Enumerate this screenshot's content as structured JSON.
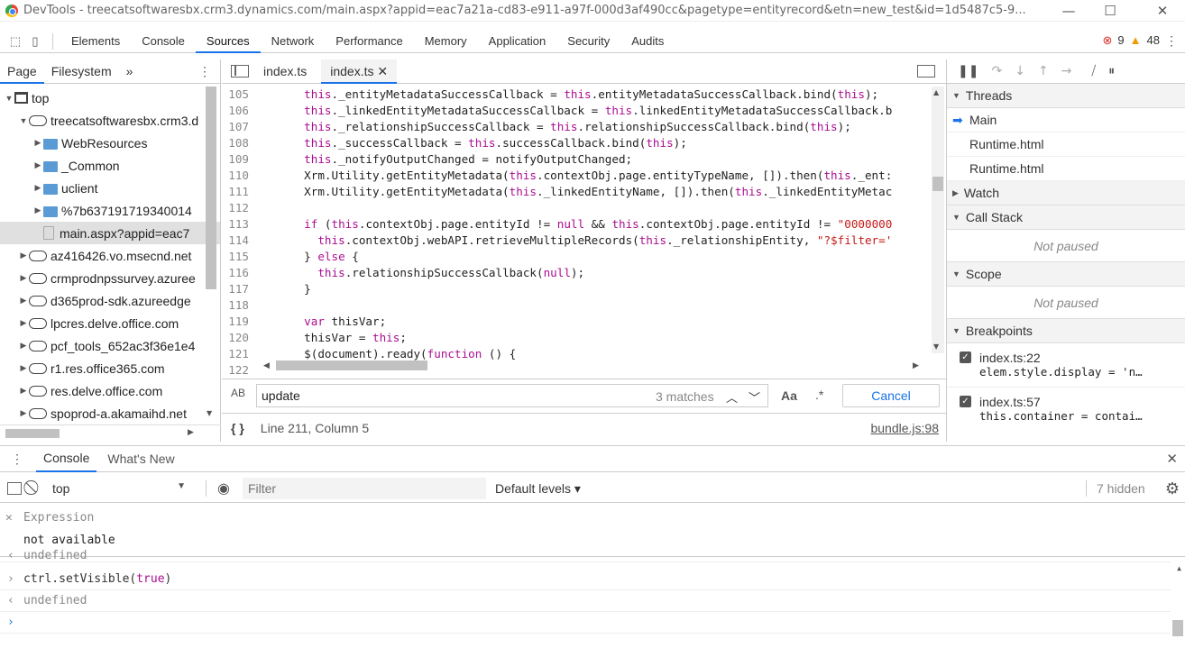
{
  "window": {
    "title": "DevTools - treecatsoftwaresbx.crm3.dynamics.com/main.aspx?appid=eac7a21a-cd83-e911-a97f-000d3af490cc&pagetype=entityrecord&etn=new_test&id=1d5487c5-9...",
    "min": "—",
    "max": "☐",
    "close": "✕"
  },
  "toolbar": {
    "tabs": [
      "Elements",
      "Console",
      "Sources",
      "Network",
      "Performance",
      "Memory",
      "Application",
      "Security",
      "Audits"
    ],
    "active": 2,
    "errors": "9",
    "warnings": "48"
  },
  "navigator": {
    "tabs": [
      "Page",
      "Filesystem"
    ],
    "more": "»",
    "tree": [
      {
        "label": "top",
        "depth": 0,
        "type": "frame",
        "arrow": "▼"
      },
      {
        "label": "treecatsoftwaresbx.crm3.d",
        "depth": 1,
        "type": "cloud",
        "arrow": "▼"
      },
      {
        "label": "WebResources",
        "depth": 2,
        "type": "folder",
        "arrow": "▶"
      },
      {
        "label": "_Common",
        "depth": 2,
        "type": "folder",
        "arrow": "▶"
      },
      {
        "label": "uclient",
        "depth": 2,
        "type": "folder",
        "arrow": "▶"
      },
      {
        "label": "%7b637191719340014",
        "depth": 2,
        "type": "folder",
        "arrow": "▶"
      },
      {
        "label": "main.aspx?appid=eac7",
        "depth": 2,
        "type": "file",
        "arrow": ""
      },
      {
        "label": "az416426.vo.msecnd.net",
        "depth": 1,
        "type": "cloud",
        "arrow": "▶"
      },
      {
        "label": "crmprodnpssurvey.azuree",
        "depth": 1,
        "type": "cloud",
        "arrow": "▶"
      },
      {
        "label": "d365prod-sdk.azureedge",
        "depth": 1,
        "type": "cloud",
        "arrow": "▶"
      },
      {
        "label": "lpcres.delve.office.com",
        "depth": 1,
        "type": "cloud",
        "arrow": "▶"
      },
      {
        "label": "pcf_tools_652ac3f36e1e4",
        "depth": 1,
        "type": "cloud",
        "arrow": "▶"
      },
      {
        "label": "r1.res.office365.com",
        "depth": 1,
        "type": "cloud",
        "arrow": "▶"
      },
      {
        "label": "res.delve.office.com",
        "depth": 1,
        "type": "cloud",
        "arrow": "▶"
      },
      {
        "label": "spoprod-a.akamaihd.net",
        "depth": 1,
        "type": "cloud",
        "arrow": "▶"
      }
    ]
  },
  "editor": {
    "tabs": [
      {
        "label": "index.ts",
        "close": ""
      },
      {
        "label": "index.ts",
        "close": "✕"
      }
    ],
    "lines": [
      {
        "n": "105",
        "html": "  this._entityMetadataSuccessCallback = this.entityMetadataSuccessCallback.bind(this);"
      },
      {
        "n": "106",
        "html": "  this._linkedEntityMetadataSuccessCallback = this.linkedEntityMetadataSuccessCallback.b"
      },
      {
        "n": "107",
        "html": "  this._relationshipSuccessCallback = this.relationshipSuccessCallback.bind(this);"
      },
      {
        "n": "108",
        "html": "  this._successCallback = this.successCallback.bind(this);"
      },
      {
        "n": "109",
        "html": "  this._notifyOutputChanged = notifyOutputChanged;"
      },
      {
        "n": "110",
        "html": "  Xrm.Utility.getEntityMetadata(this.contextObj.page.entityTypeName, []).then(this._ent:"
      },
      {
        "n": "111",
        "html": "  Xrm.Utility.getEntityMetadata(this._linkedEntityName, []).then(this._linkedEntityMetac"
      },
      {
        "n": "112",
        "html": ""
      },
      {
        "n": "113",
        "html": "  if (this.contextObj.page.entityId != null && this.contextObj.page.entityId != \"0000000"
      },
      {
        "n": "114",
        "html": "    this.contextObj.webAPI.retrieveMultipleRecords(this._relationshipEntity, \"?$filter='"
      },
      {
        "n": "115",
        "html": "  } else {"
      },
      {
        "n": "116",
        "html": "    this.relationshipSuccessCallback(null);"
      },
      {
        "n": "117",
        "html": "  }"
      },
      {
        "n": "118",
        "html": ""
      },
      {
        "n": "119",
        "html": "  var thisVar;"
      },
      {
        "n": "120",
        "html": "  thisVar = this;"
      },
      {
        "n": "121",
        "html": "  $(document).ready(function () {"
      },
      {
        "n": "122",
        "html": ""
      }
    ],
    "search": {
      "value": "update",
      "matches": "3 matches",
      "case": "Aa",
      "regex": ".*",
      "cancel": "Cancel",
      "ab": "AB"
    },
    "status": {
      "position": "Line 211, Column 5",
      "source": "bundle.js:98",
      "braces": "{ }"
    }
  },
  "debugger": {
    "threads": {
      "title": "Threads",
      "items": [
        "Main",
        "Runtime.html",
        "Runtime.html"
      ]
    },
    "watch": "Watch",
    "callstack": {
      "title": "Call Stack",
      "empty": "Not paused"
    },
    "scope": {
      "title": "Scope",
      "empty": "Not paused"
    },
    "breakpoints": {
      "title": "Breakpoints",
      "items": [
        {
          "file": "index.ts:22",
          "code": "elem.style.display = 'n…"
        },
        {
          "file": "index.ts:57",
          "code": "this.container = contai…"
        }
      ]
    }
  },
  "drawer": {
    "tabs": [
      "Console",
      "What's New"
    ],
    "context": "top",
    "filter_placeholder": "Filter",
    "levels": "Default levels ▾",
    "hidden": "7 hidden"
  },
  "console": {
    "expression_label": "Expression",
    "expression_value": "not available",
    "lines": [
      {
        "prefix": "‹",
        "text": "undefined",
        "kind": "result"
      },
      {
        "prefix": "›",
        "text": "ctrl.setVisible(true)",
        "kind": "input"
      },
      {
        "prefix": "‹",
        "text": "undefined",
        "kind": "result"
      },
      {
        "prefix": "›",
        "text": "",
        "kind": "prompt"
      }
    ]
  }
}
